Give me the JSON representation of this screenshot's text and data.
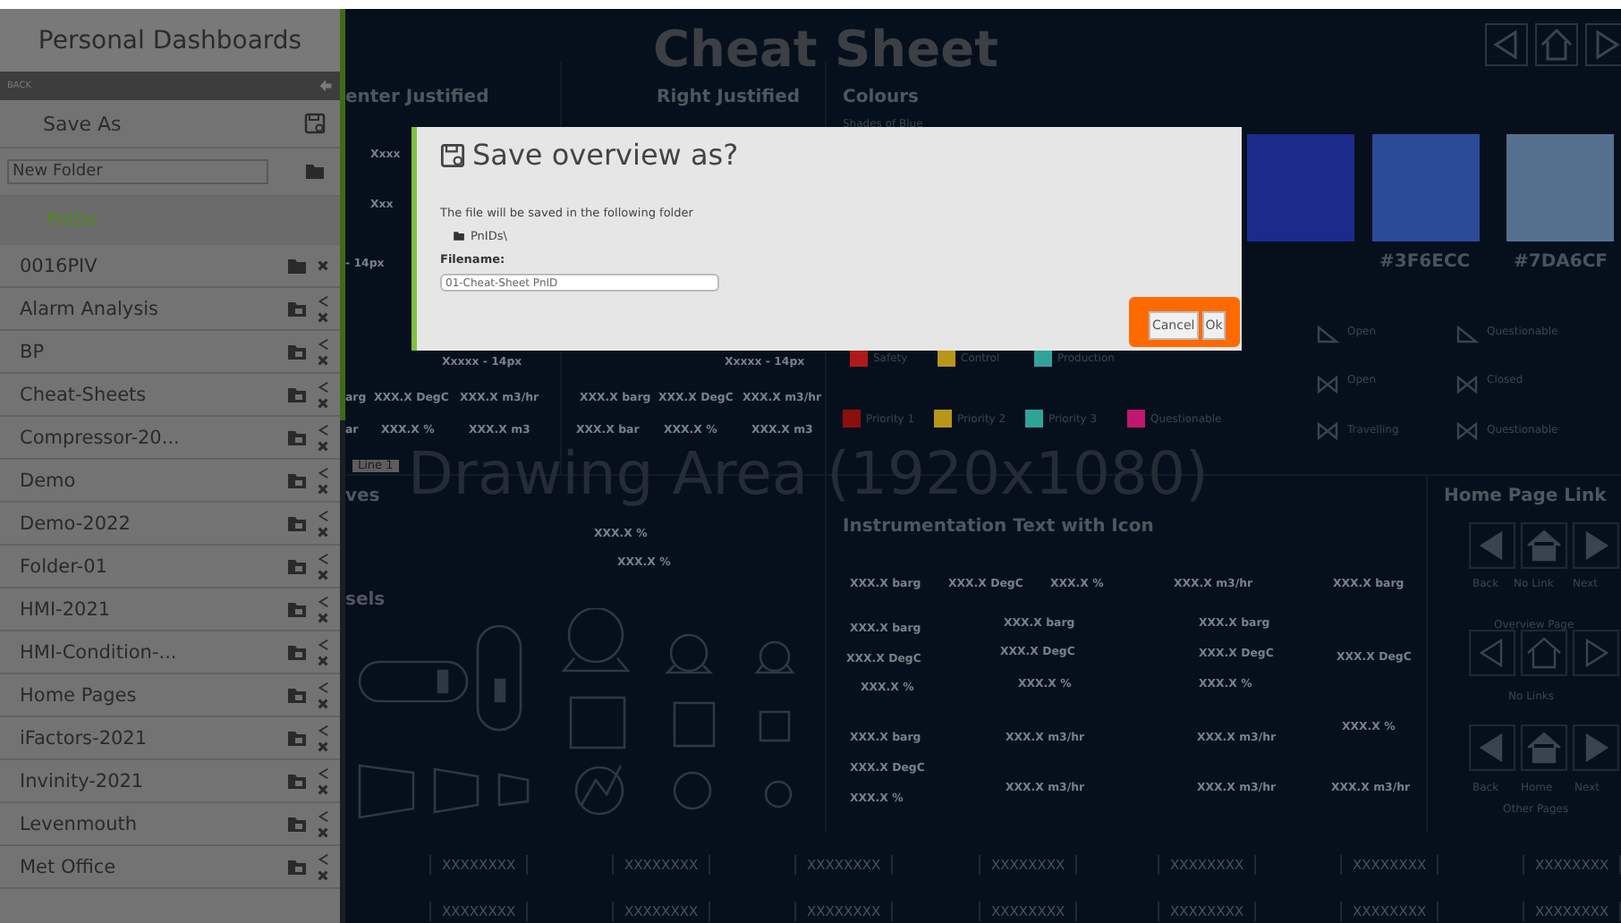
{
  "sidebar": {
    "title": "Personal Dashboards",
    "back_label": "BACK",
    "save_as": "Save As",
    "new_folder_value": "New Folder",
    "current_folder": "PnIDs",
    "folders": [
      {
        "name": "0016PIV",
        "shared": false
      },
      {
        "name": "Alarm Analysis",
        "shared": true
      },
      {
        "name": "BP",
        "shared": true
      },
      {
        "name": "Cheat-Sheets",
        "shared": true
      },
      {
        "name": "Compressor-20...",
        "shared": true
      },
      {
        "name": "Demo",
        "shared": true
      },
      {
        "name": "Demo-2022",
        "shared": true
      },
      {
        "name": "Folder-01",
        "shared": true
      },
      {
        "name": "HMI-2021",
        "shared": true
      },
      {
        "name": "HMI-Condition-...",
        "shared": true
      },
      {
        "name": "Home Pages",
        "shared": true
      },
      {
        "name": "iFactors-2021",
        "shared": true
      },
      {
        "name": "Invinity-2021",
        "shared": true
      },
      {
        "name": "Levenmouth",
        "shared": true
      },
      {
        "name": "Met Office",
        "shared": true
      }
    ]
  },
  "canvas": {
    "title": "Cheat Sheet",
    "area_label": "Drawing Area (1920x1080)",
    "texts": [
      {
        "text": "enter Justified",
        "kind": "heading"
      },
      {
        "text": "Right Justified",
        "kind": "heading"
      },
      {
        "text": "Colours",
        "kind": "heading"
      },
      {
        "text": "Shades of Blue",
        "kind": "small"
      },
      {
        "text": "Xxxx",
        "kind": "value"
      },
      {
        "text": "Xxx",
        "kind": "value"
      },
      {
        "text": "- 14px",
        "kind": "value"
      },
      {
        "text": "Xxxxx - 14px",
        "kind": "value"
      },
      {
        "text": "Xxxxx - 14px",
        "kind": "value"
      },
      {
        "text": "arg",
        "kind": "value"
      },
      {
        "text": "XXX.X DegC",
        "kind": "value"
      },
      {
        "text": "XXX.X m3/hr",
        "kind": "value"
      },
      {
        "text": "XXX.X barg",
        "kind": "value"
      },
      {
        "text": "XXX.X DegC",
        "kind": "value"
      },
      {
        "text": "XXX.X m3/hr",
        "kind": "value"
      },
      {
        "text": "ar",
        "kind": "value"
      },
      {
        "text": "XXX.X %",
        "kind": "value"
      },
      {
        "text": "XXX.X m3",
        "kind": "value"
      },
      {
        "text": "XXX.X bar",
        "kind": "value"
      },
      {
        "text": "XXX.X %",
        "kind": "value"
      },
      {
        "text": "XXX.X m3",
        "kind": "value"
      },
      {
        "text": "Line 1",
        "kind": "badge"
      },
      {
        "text": "ves",
        "kind": "heading"
      },
      {
        "text": "XXX.X %",
        "kind": "value"
      },
      {
        "text": "XXX.X %",
        "kind": "value"
      },
      {
        "text": "sels",
        "kind": "heading"
      },
      {
        "text": "Instrumentation Text with Icon",
        "kind": "heading"
      },
      {
        "text": "Home Page Link",
        "kind": "heading"
      },
      {
        "text": "XXX.X barg",
        "kind": "value"
      },
      {
        "text": "XXX.X DegC",
        "kind": "value"
      },
      {
        "text": "XXX.X %",
        "kind": "value"
      },
      {
        "text": "XXX.X m3/hr",
        "kind": "value"
      },
      {
        "text": "XXX.X barg",
        "kind": "value"
      },
      {
        "text": "XXX.X barg",
        "kind": "value"
      },
      {
        "text": "XXX.X DegC",
        "kind": "value"
      },
      {
        "text": "XXX.X %",
        "kind": "value"
      },
      {
        "text": "XXX.X barg",
        "kind": "value"
      },
      {
        "text": "XXX.X DegC",
        "kind": "value"
      },
      {
        "text": "XXX.X %",
        "kind": "value"
      },
      {
        "text": "XXX.X barg",
        "kind": "value"
      },
      {
        "text": "XXX.X DegC",
        "kind": "value"
      },
      {
        "text": "XXX.X %",
        "kind": "value"
      },
      {
        "text": "XXX.X DegC",
        "kind": "value"
      },
      {
        "text": "XXX.X %",
        "kind": "value"
      },
      {
        "text": "XXX.X barg",
        "kind": "value"
      },
      {
        "text": "XXX.X DegC",
        "kind": "value"
      },
      {
        "text": "XXX.X %",
        "kind": "value"
      },
      {
        "text": "XXX.X m3/hr",
        "kind": "value"
      },
      {
        "text": "XXX.X m3/hr",
        "kind": "value"
      },
      {
        "text": "XXX.X m3/hr",
        "kind": "value"
      },
      {
        "text": "XXX.X m3/hr",
        "kind": "value"
      },
      {
        "text": "XXX.X m3/hr",
        "kind": "value"
      },
      {
        "text": "Back",
        "kind": "small"
      },
      {
        "text": "No Link",
        "kind": "small"
      },
      {
        "text": "Next",
        "kind": "small"
      },
      {
        "text": "Overview Page",
        "kind": "small"
      },
      {
        "text": "No Links",
        "kind": "small"
      },
      {
        "text": "Back",
        "kind": "small"
      },
      {
        "text": "Home",
        "kind": "small"
      },
      {
        "text": "Next",
        "kind": "small"
      },
      {
        "text": "Other Pages",
        "kind": "small"
      },
      {
        "text": "Open",
        "kind": "small"
      },
      {
        "text": "Open",
        "kind": "small"
      },
      {
        "text": "Travelling",
        "kind": "small"
      },
      {
        "text": "Questionable",
        "kind": "small"
      },
      {
        "text": "Closed",
        "kind": "small"
      },
      {
        "text": "Questionable",
        "kind": "small"
      }
    ],
    "legend": [
      {
        "label": "Safety",
        "color": "#b01a1a"
      },
      {
        "label": "Control",
        "color": "#b8961a"
      },
      {
        "label": "Production",
        "color": "#2fa39a"
      },
      {
        "label": "Priority 1",
        "color": "#8b0f0f"
      },
      {
        "label": "Priority 2",
        "color": "#b8961a"
      },
      {
        "label": "Priority 3",
        "color": "#2fa39a"
      },
      {
        "label": "Questionable",
        "color": "#c0186e"
      }
    ],
    "swatches": [
      {
        "color": "#1c2a8c"
      },
      {
        "color": "#2b4a98",
        "label": "#3F6ECC"
      },
      {
        "color": "#56708f",
        "label": "#7DA6CF"
      }
    ],
    "tags": [
      "XXXXXXXX",
      "XXXXXXXX",
      "XXXXXXXX",
      "XXXXXXXX",
      "XXXXXXXX",
      "XXXXXXXX",
      "XXXXXXXX",
      "XXXXXXXX",
      "XXXXXXXX",
      "XXXXXXXX",
      "XXXXXXXX",
      "XXXXXXXX",
      "XXXXXXXX",
      "XXXXXXXX"
    ]
  },
  "dialog": {
    "title": "Save overview as?",
    "message": "The file will be saved in the following folder",
    "folder": "PnIDs\\",
    "filename_label": "Filename:",
    "filename_value": "01-Cheat-Sheet PnID",
    "buttons_highlighted": true,
    "buttons": [
      {
        "label": "Cancel"
      },
      {
        "label": "Ok"
      }
    ]
  }
}
